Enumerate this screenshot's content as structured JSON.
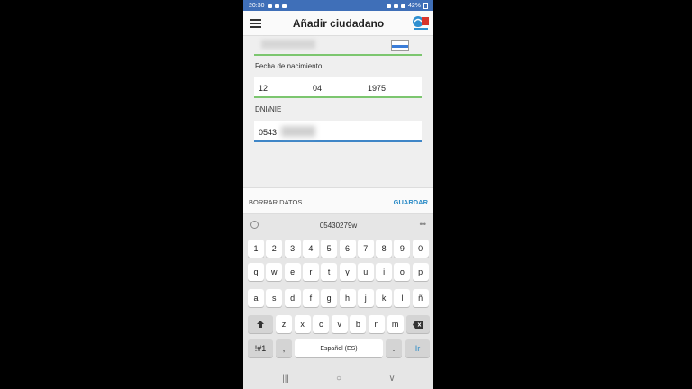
{
  "status_bar": {
    "time": "20:30",
    "battery": "42%"
  },
  "app": {
    "title": "Añadir ciudadano"
  },
  "form": {
    "dob_label": "Fecha de nacimiento",
    "dob_day": "12",
    "dob_month": "04",
    "dob_year": "1975",
    "dni_label": "DNI/NIE",
    "dni_value": "0543"
  },
  "actions": {
    "clear_label": "BORRAR DATOS",
    "save_label": "GUARDAR"
  },
  "keyboard": {
    "suggestion": "05430279w",
    "number_row": [
      "1",
      "2",
      "3",
      "4",
      "5",
      "6",
      "7",
      "8",
      "9",
      "0"
    ],
    "row1": [
      "q",
      "w",
      "e",
      "r",
      "t",
      "y",
      "u",
      "i",
      "o",
      "p"
    ],
    "row2": [
      "a",
      "s",
      "d",
      "f",
      "g",
      "h",
      "j",
      "k",
      "l",
      "ñ"
    ],
    "row3": [
      "z",
      "x",
      "c",
      "v",
      "b",
      "n",
      "m"
    ],
    "symbols_label": "!#1",
    "comma_label": ",",
    "space_label": "Español (ES)",
    "period_label": ".",
    "ir_label": "Ir"
  },
  "colors": {
    "statusbar": "#3f6fb8",
    "accent_green": "#7cc66f",
    "accent_blue": "#3f86c7",
    "save_blue": "#2d8cc7"
  }
}
